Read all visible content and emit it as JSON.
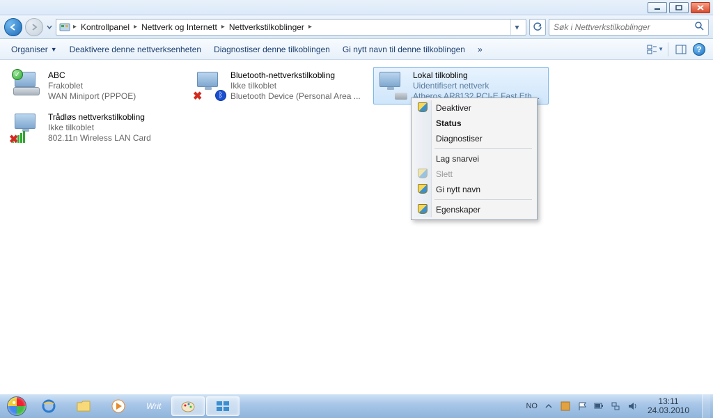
{
  "titlebar": {},
  "nav": {
    "crumbs": [
      "Kontrollpanel",
      "Nettverk og Internett",
      "Nettverkstilkoblinger"
    ],
    "search_placeholder": "Søk i Nettverkstilkoblinger"
  },
  "cmdbar": {
    "organize": "Organiser",
    "disable": "Deaktivere denne nettverksenheten",
    "diagnose": "Diagnostiser denne tilkoblingen",
    "rename": "Gi nytt navn til denne tilkoblingen",
    "overflow": "»"
  },
  "connections": [
    {
      "name": "ABC",
      "line2": "Frakoblet",
      "line3": "WAN Miniport (PPPOE)",
      "kind": "modem",
      "overlay": "ok"
    },
    {
      "name": "Bluetooth-nettverkstilkobling",
      "line2": "Ikke tilkoblet",
      "line3": "Bluetooth Device (Personal Area ...",
      "kind": "monitor",
      "overlay": "bt_x"
    },
    {
      "name": "Lokal tilkobling",
      "line2": "Uidentifisert nettverk",
      "line3": "Atheros AR8132 PCI-E Fast Ethern...",
      "kind": "monitor",
      "overlay": "plug",
      "selected": true
    },
    {
      "name": "Trådløs nettverkstilkobling",
      "line2": "Ikke tilkoblet",
      "line3": "802.11n Wireless LAN Card",
      "kind": "monitor",
      "overlay": "wifi_x"
    }
  ],
  "context_menu": {
    "items": [
      {
        "label": "Deaktiver",
        "shield": true
      },
      {
        "label": "Status",
        "bold": true
      },
      {
        "label": "Diagnostiser"
      },
      {
        "sep": true
      },
      {
        "label": "Lag snarvei"
      },
      {
        "label": "Slett",
        "shield": true,
        "disabled": true
      },
      {
        "label": "Gi nytt navn",
        "shield": true
      },
      {
        "sep": true
      },
      {
        "label": "Egenskaper",
        "shield": true
      }
    ]
  },
  "tray": {
    "lang": "NO",
    "time": "13:11",
    "date": "24.03.2010"
  }
}
